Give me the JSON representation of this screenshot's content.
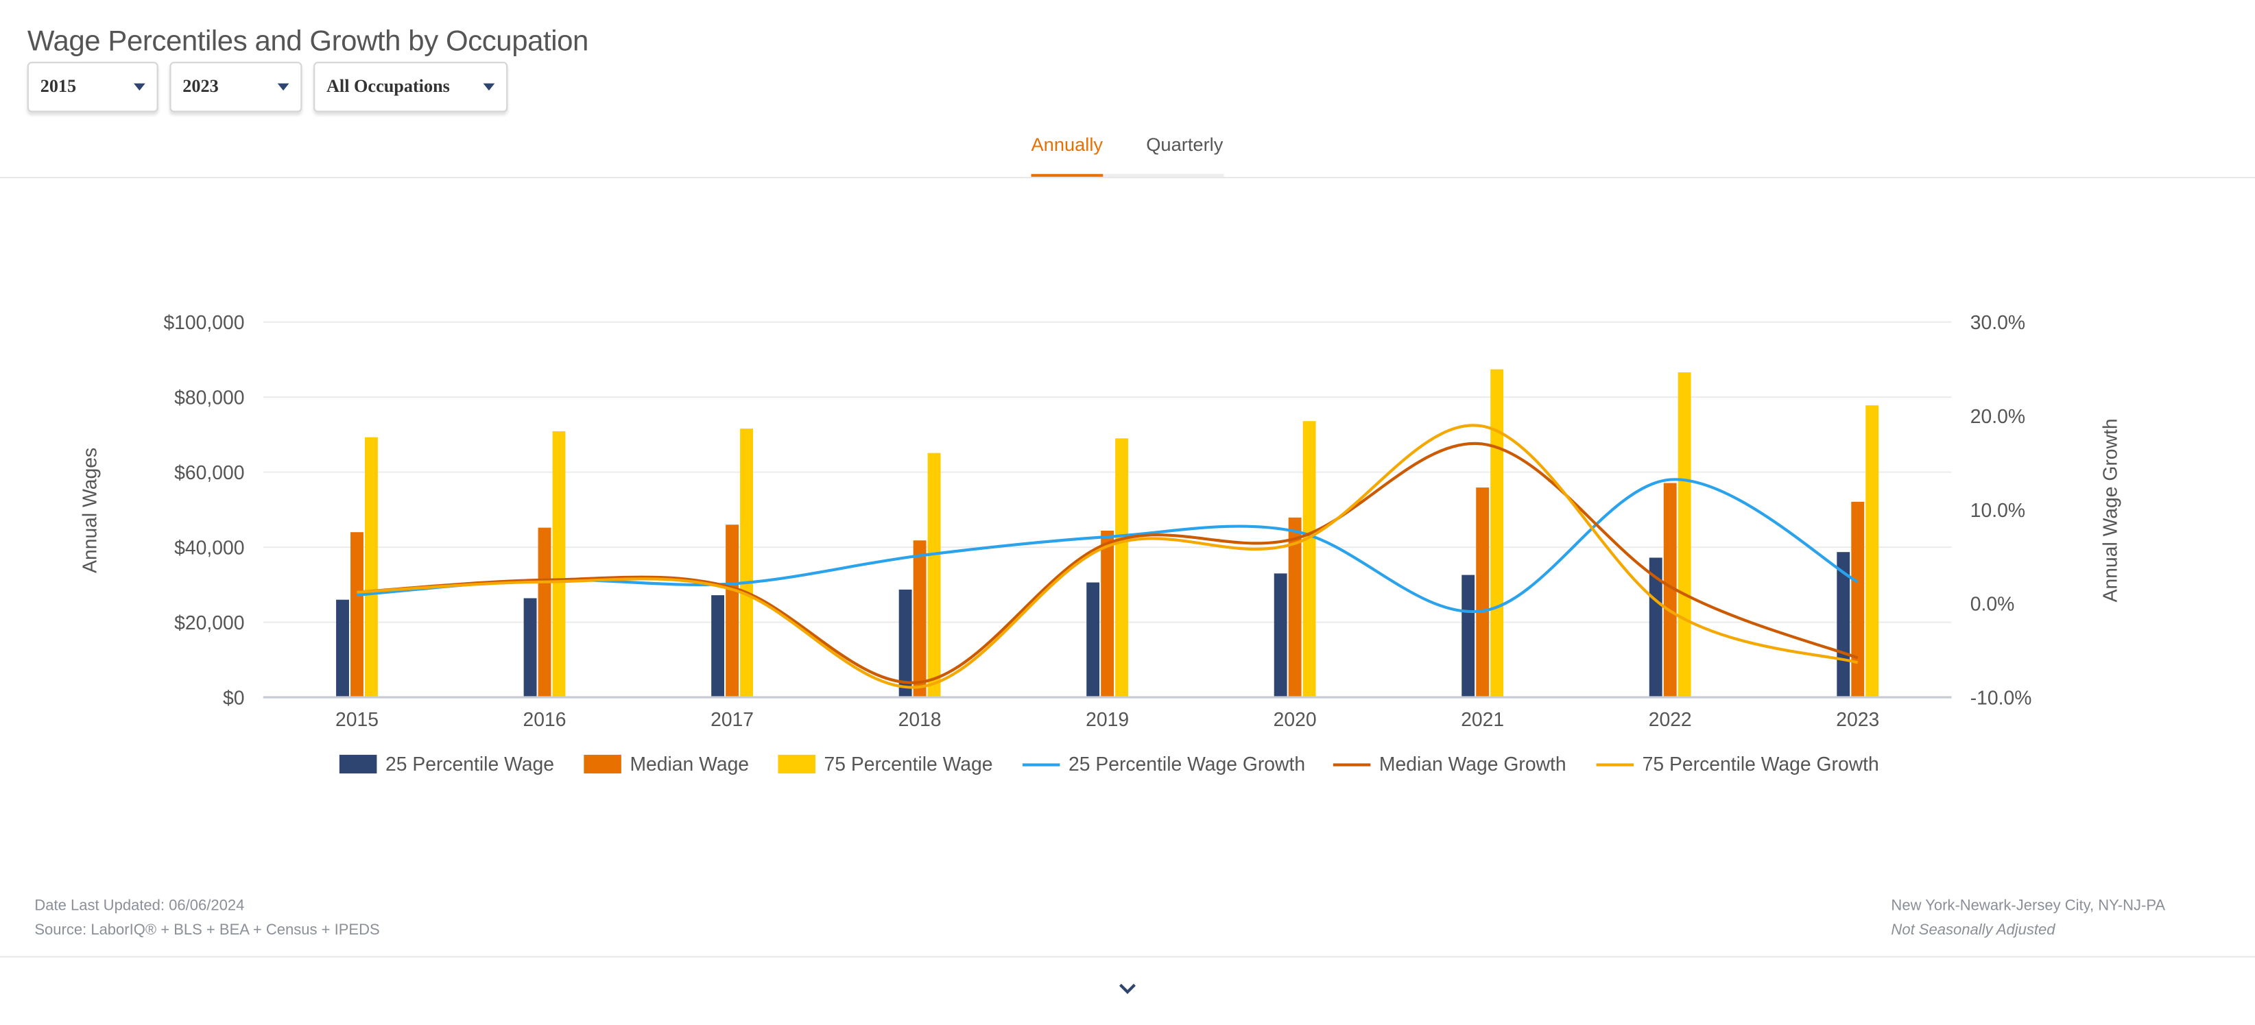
{
  "header": {
    "title": "Wage Percentiles and Growth by Occupation"
  },
  "filters": {
    "start_year": "2015",
    "end_year": "2023",
    "occupation": "All Occupations"
  },
  "tabs": [
    {
      "label": "Annually",
      "active": true
    },
    {
      "label": "Quarterly",
      "active": false
    }
  ],
  "colors": {
    "accent": "#e87000",
    "p25": "#2e4571",
    "median": "#e87000",
    "p75": "#ffcc00",
    "p25_growth": "#2aa3ec",
    "median_growth": "#cc5a00",
    "p75_growth": "#f5a800"
  },
  "chart_data": {
    "type": "bar+line",
    "categories": [
      "2015",
      "2016",
      "2017",
      "2018",
      "2019",
      "2020",
      "2021",
      "2022",
      "2023"
    ],
    "ylabel": "Annual Wages",
    "y2label": "Annual Wage Growth",
    "ylim": [
      0,
      100000
    ],
    "y2lim": [
      -10,
      30
    ],
    "yticks": [
      "$0",
      "$20,000",
      "$40,000",
      "$60,000",
      "$80,000",
      "$100,000"
    ],
    "y2ticks": [
      "-10.0%",
      "0.0%",
      "10.0%",
      "20.0%",
      "30.0%"
    ],
    "grid": true,
    "legend": "bottom",
    "bar_series": [
      {
        "name": "25 Percentile Wage",
        "values": [
          26000,
          26400,
          27200,
          28700,
          30600,
          33000,
          32600,
          37200,
          38700
        ]
      },
      {
        "name": "Median Wage",
        "values": [
          44000,
          45200,
          46000,
          41800,
          44400,
          47900,
          55900,
          57100,
          52100
        ]
      },
      {
        "name": "75 Percentile Wage",
        "values": [
          69300,
          70900,
          71600,
          65100,
          69000,
          73600,
          87400,
          86600,
          77800
        ]
      }
    ],
    "line_series": [
      {
        "name": "25 Percentile Wage Growth",
        "values": [
          0.9,
          2.5,
          2.1,
          5.1,
          7.1,
          7.7,
          -0.8,
          13.2,
          2.3
        ]
      },
      {
        "name": "Median Wage Growth",
        "values": [
          1.2,
          2.5,
          1.7,
          -8.4,
          6.4,
          6.9,
          17.0,
          1.8,
          -5.8
        ]
      },
      {
        "name": "75 Percentile Wage Growth",
        "values": [
          1.2,
          2.3,
          1.5,
          -8.9,
          6.1,
          6.4,
          18.9,
          -0.8,
          -6.3
        ]
      }
    ]
  },
  "footer": {
    "updated": "Date Last Updated: 06/06/2024",
    "source": "Source: LaborIQ® + BLS + BEA + Census + IPEDS",
    "region": "New York-Newark-Jersey City, NY-NJ-PA",
    "adjustment": "Not Seasonally Adjusted"
  },
  "icons": {
    "expand": "chevron-down-icon",
    "dropdown": "caret-down-icon"
  }
}
